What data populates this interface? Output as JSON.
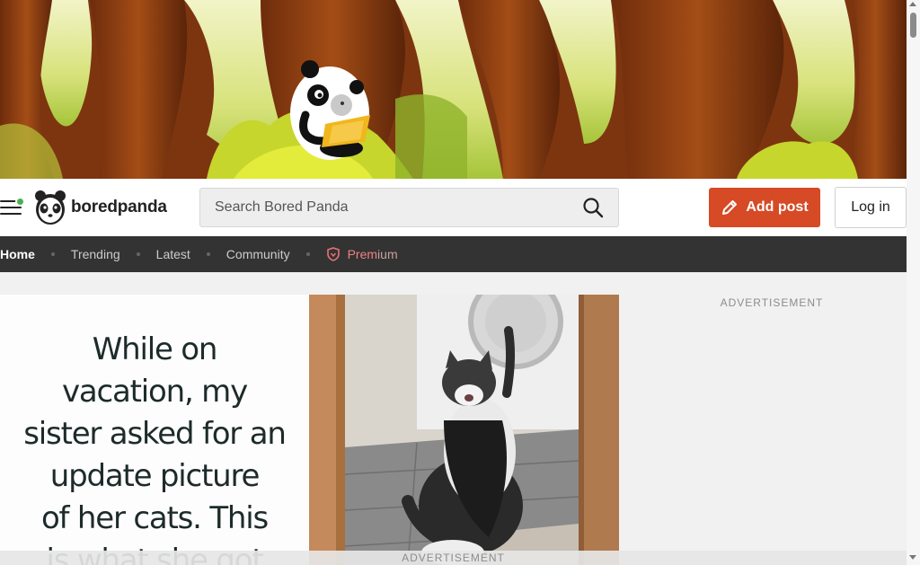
{
  "header": {
    "logo_text": "boredpanda",
    "search_placeholder": "Search Bored Panda",
    "add_post_label": "Add post",
    "login_label": "Log in",
    "accent_color": "#d64a25",
    "notification_color": "#4caf50"
  },
  "nav": {
    "items": [
      {
        "label": "Home",
        "active": true
      },
      {
        "label": "Trending"
      },
      {
        "label": "Latest"
      },
      {
        "label": "Community"
      }
    ],
    "premium_label_a": "Prem",
    "premium_label_b": "ium"
  },
  "post": {
    "caption_lines": [
      "While on",
      "vacation, my",
      "sister asked for an",
      "update picture",
      "of her cats. This",
      "is what she got"
    ]
  },
  "sidebar": {
    "ad_label": "ADVERTISEMENT"
  },
  "bottom_ad": {
    "label": "ADVERTISEMENT"
  }
}
